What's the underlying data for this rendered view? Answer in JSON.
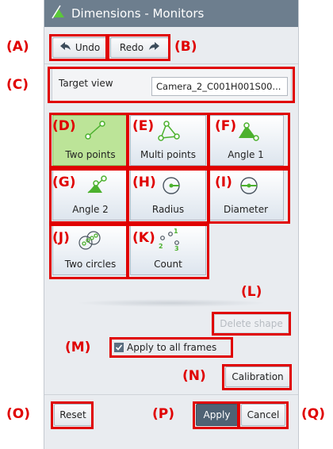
{
  "window": {
    "title": "Dimensions - Monitors"
  },
  "toolbar": {
    "undo_label": "Undo",
    "redo_label": "Redo"
  },
  "target": {
    "label": "Target view",
    "value": "Camera_2_C001H001S00..."
  },
  "tools": [
    {
      "label": "Two points",
      "icon": "two-points-icon",
      "active": true
    },
    {
      "label": "Multi points",
      "icon": "multi-points-icon"
    },
    {
      "label": "Angle 1",
      "icon": "angle-1-icon"
    },
    {
      "label": "Angle 2",
      "icon": "angle-2-icon"
    },
    {
      "label": "Radius",
      "icon": "radius-icon"
    },
    {
      "label": "Diameter",
      "icon": "diameter-icon"
    },
    {
      "label": "Two circles",
      "icon": "two-circles-icon"
    },
    {
      "label": "Count",
      "icon": "count-icon"
    }
  ],
  "actions": {
    "delete_shape": "Delete shape",
    "apply_all_frames": "Apply to all frames",
    "apply_all_checked": true,
    "calibration": "Calibration",
    "reset": "Reset",
    "apply": "Apply",
    "cancel": "Cancel"
  },
  "callouts": [
    "(A)",
    "(B)",
    "(C)",
    "(D)",
    "(E)",
    "(F)",
    "(G)",
    "(H)",
    "(I)",
    "(J)",
    "(K)",
    "(L)",
    "(M)",
    "(N)",
    "(O)",
    "(P)",
    "(Q)"
  ],
  "colors": {
    "titlebar": "#6d7e8e",
    "active_tool": "#bce498",
    "annotation": "#e00000",
    "apply": "#4f6274",
    "icon_green": "#4cb12e"
  }
}
